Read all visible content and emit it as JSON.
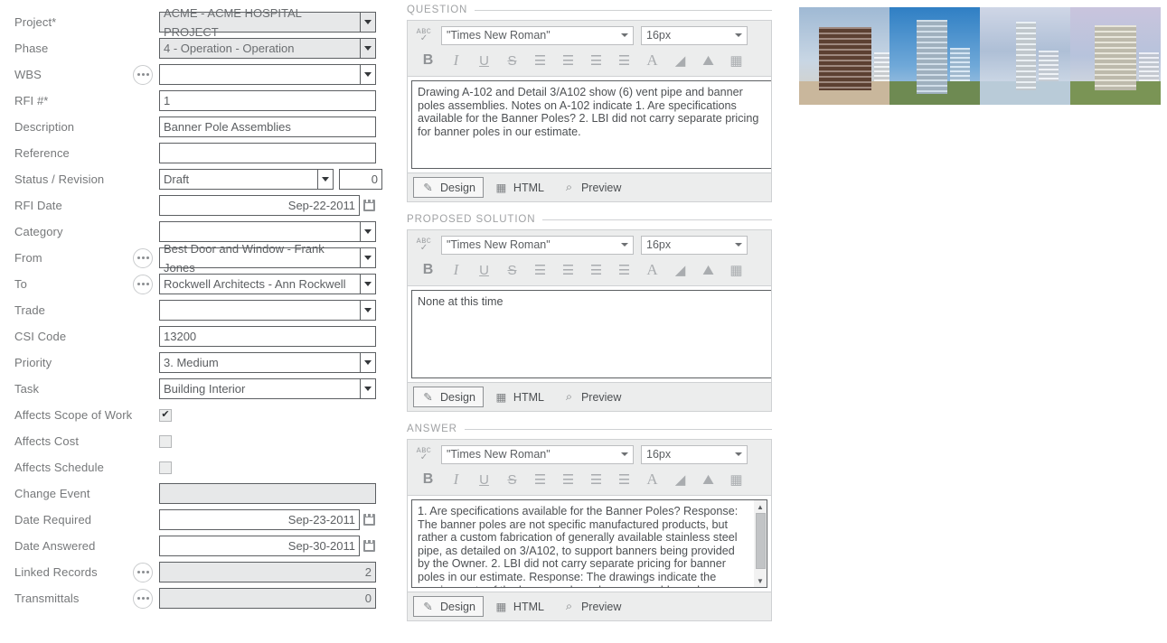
{
  "form": {
    "fields": [
      {
        "label": "Project*",
        "value": "ACME - ACME HOSPITAL PROJECT",
        "type": "select",
        "disabled": true
      },
      {
        "label": "Phase",
        "value": "4 - Operation - Operation",
        "type": "select",
        "disabled": true
      },
      {
        "label": "WBS",
        "value": "",
        "type": "select",
        "dots": true
      },
      {
        "label": "RFI #*",
        "value": "1",
        "type": "text"
      },
      {
        "label": "Description",
        "value": "Banner Pole Assemblies",
        "type": "text"
      },
      {
        "label": "Reference",
        "value": "",
        "type": "text"
      },
      {
        "label": "Status / Revision",
        "value": "Draft",
        "type": "status",
        "revision": "0"
      },
      {
        "label": "RFI Date",
        "value": "Sep-22-2011",
        "type": "date"
      },
      {
        "label": "Category",
        "value": "",
        "type": "select"
      },
      {
        "label": "From",
        "value": "Best Door and Window - Frank Jones",
        "type": "select",
        "dots": true
      },
      {
        "label": "To",
        "value": "Rockwell Architects - Ann Rockwell",
        "type": "select",
        "dots": true
      },
      {
        "label": "Trade",
        "value": "",
        "type": "select"
      },
      {
        "label": "CSI Code",
        "value": "13200",
        "type": "text"
      },
      {
        "label": "Priority",
        "value": "3. Medium",
        "type": "select"
      },
      {
        "label": "Task",
        "value": "Building Interior",
        "type": "select"
      },
      {
        "label": "Affects Scope of Work",
        "value": "",
        "type": "checkbox",
        "checked": true
      },
      {
        "label": "Affects Cost",
        "value": "",
        "type": "checkbox",
        "checked": false
      },
      {
        "label": "Affects Schedule",
        "value": "",
        "type": "checkbox",
        "checked": false
      },
      {
        "label": "Change Event",
        "value": "",
        "type": "text",
        "disabled": true
      },
      {
        "label": "Date Required",
        "value": "Sep-23-2011",
        "type": "date"
      },
      {
        "label": "Date Answered",
        "value": "Sep-30-2011",
        "type": "date"
      },
      {
        "label": "Linked Records",
        "value": "2",
        "type": "text",
        "disabled": true,
        "dots": true,
        "align": "right"
      },
      {
        "label": "Transmittals",
        "value": "0",
        "type": "text",
        "disabled": true,
        "dots": true,
        "align": "right"
      }
    ]
  },
  "editors": {
    "toolbar": {
      "spellcheck_label": "ABC",
      "spellcheck_mark": "✓",
      "font_value": "\"Times New Roman\"",
      "size_value": "16px",
      "buttons": [
        {
          "name": "bold-button",
          "glyph": "B"
        },
        {
          "name": "italic-button",
          "glyph": "I"
        },
        {
          "name": "underline-button",
          "glyph": "U"
        },
        {
          "name": "strikethrough-button",
          "glyph": "S"
        },
        {
          "name": "align-left-button",
          "glyph": "☰"
        },
        {
          "name": "align-center-button",
          "glyph": "☰"
        },
        {
          "name": "align-right-button",
          "glyph": "☰"
        },
        {
          "name": "align-justify-button",
          "glyph": "☰"
        },
        {
          "name": "font-color-button",
          "glyph": "A"
        },
        {
          "name": "fill-color-button",
          "glyph": "◢"
        },
        {
          "name": "insert-image-button",
          "glyph": "⛰"
        },
        {
          "name": "insert-table-button",
          "glyph": "▦"
        }
      ]
    },
    "tabs": [
      {
        "label": "Design",
        "icon": "pencil-icon",
        "glyph": "✎",
        "active": true
      },
      {
        "label": "HTML",
        "icon": "table-icon",
        "glyph": "▦",
        "active": false
      },
      {
        "label": "Preview",
        "icon": "magnifier-plus-icon",
        "glyph": "⌕",
        "active": false
      }
    ],
    "question": {
      "section_title": "QUESTION",
      "body": "Drawing A-102 and Detail 3/A102 show (6) vent pipe and banner poles assemblies. Notes on A-102 indicate 1. Are specifications available for the Banner Poles? 2. LBI did not carry separate pricing for banner poles in our estimate."
    },
    "proposed_solution": {
      "section_title": "PROPOSED SOLUTION",
      "body": "None at this time"
    },
    "answer": {
      "section_title": "ANSWER",
      "body": "1. Are specifications available for the Banner Poles? Response: The banner poles are not specific manufactured products, but rather a custom fabrication of generally available stainless steel pipe, as detailed on 3/A102, to support banners being provided by the Owner.   2. LBI did not carry separate pricing for banner poles in our estimate. Response: The drawings indicate the requirements of the banner pole and arm assembly, and are a contract"
    }
  },
  "gallery": {
    "images": [
      {
        "name": "building-photo-brown-office",
        "alt": "Brown brick office building exterior"
      },
      {
        "name": "building-photo-glass-highrise",
        "alt": "Glass high-rise tower rendering"
      },
      {
        "name": "building-photo-waterfront-tower",
        "alt": "Waterfront residential tower rendering"
      },
      {
        "name": "building-photo-midrise-rendering",
        "alt": "Mid-rise building elevation rendering"
      }
    ]
  },
  "colors": {
    "label": "#76787a",
    "field_border": "#5c5f62",
    "disabled_bg": "#e7e8e9",
    "toolbar_bg": "#eceded",
    "section_title": "#a0a2a4"
  }
}
